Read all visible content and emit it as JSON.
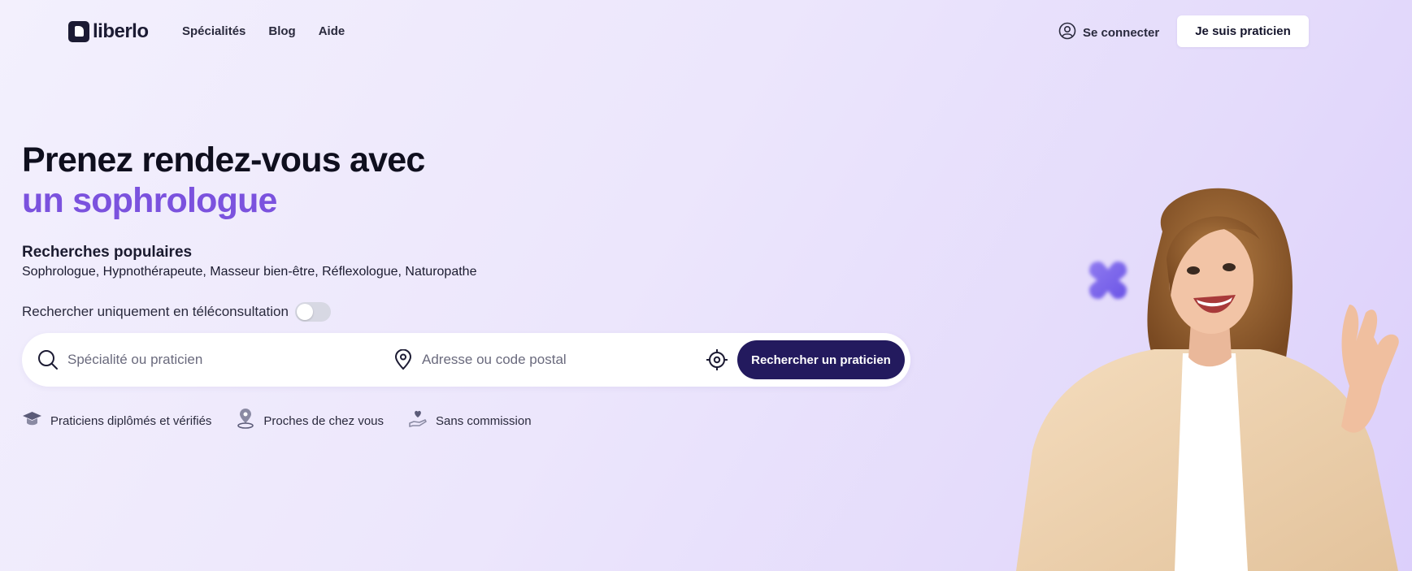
{
  "header": {
    "logo_text": "liberlo",
    "nav": [
      "Spécialités",
      "Blog",
      "Aide"
    ],
    "connect_label": "Se connecter",
    "pro_button": "Je suis praticien"
  },
  "hero": {
    "title_line1": "Prenez rendez-vous avec",
    "title_line2": "un sophrologue",
    "popular_title": "Recherches populaires",
    "popular_list": "Sophrologue, Hypnothérapeute, Masseur bien-être, Réflexologue, Naturopathe",
    "tele_label": "Rechercher uniquement en téléconsultation"
  },
  "search": {
    "specialty_placeholder": "Spécialité ou praticien",
    "address_placeholder": "Adresse ou code postal",
    "button": "Rechercher un praticien"
  },
  "features": [
    "Praticiens diplômés et vérifiés",
    "Proches de chez vous",
    "Sans commission"
  ],
  "colors": {
    "accent": "#7b52de",
    "primary_button": "#231a5e",
    "text_dark": "#0f0f1e"
  }
}
